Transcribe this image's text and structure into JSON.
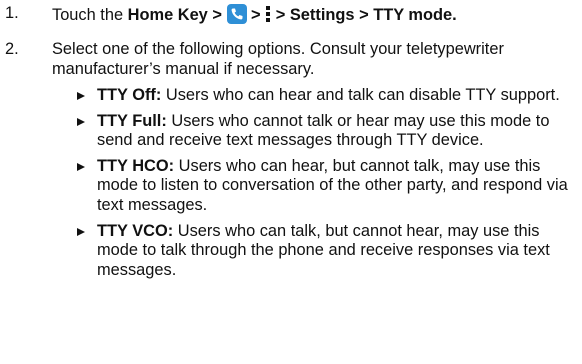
{
  "steps": [
    {
      "number": "1.",
      "parts": {
        "pre": "Touch the ",
        "home": "Home Key >",
        "sep1": " > ",
        "sep2": " > ",
        "path": "Settings > TTY mode",
        "end": "."
      },
      "icons": [
        "phone-icon",
        "menu-icon"
      ]
    },
    {
      "number": "2.",
      "text": "Select one of the following options. Consult your teletypewriter manufacturer’s manual if necessary."
    }
  ],
  "options": [
    {
      "label": "TTY Off:",
      "text": " Users who can hear and talk can disable TTY support."
    },
    {
      "label": "TTY Full:",
      "text": " Users who cannot talk or hear may use this mode to send and receive text messages through TTY device."
    },
    {
      "label": "TTY HCO:",
      "text": " Users who can hear, but cannot talk, may use this mode to listen to conversation of the other party, and respond via text messages."
    },
    {
      "label": "TTY VCO:",
      "text": " Users who can talk, but cannot hear, may use this mode to talk through the phone and receive responses via text messages."
    }
  ],
  "colors": {
    "text": "#111111",
    "phone_icon_bg": "#2e8fd6"
  }
}
